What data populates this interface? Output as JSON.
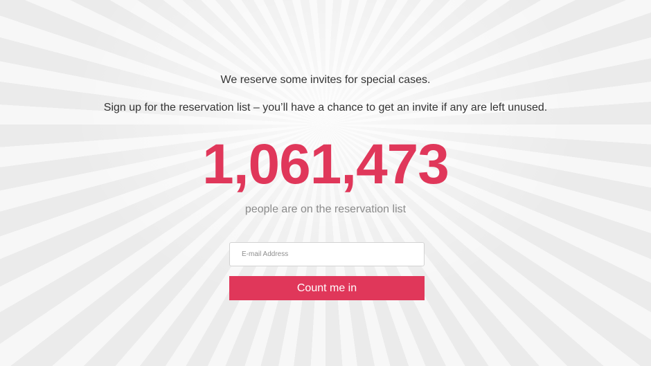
{
  "intro": {
    "line1": "We reserve some invites for special cases.",
    "line2": "Sign up for the reservation list – you’ll have a chance to get an invite if any are left unused."
  },
  "counter": {
    "value": "1,061,473",
    "caption": "people are on the reservation list"
  },
  "form": {
    "email_placeholder": "E-mail Address",
    "email_value": "",
    "submit_label": "Count me in"
  },
  "colors": {
    "accent": "#e0375a",
    "text": "#333333",
    "muted": "#8b8b8b",
    "background": "#efefef"
  }
}
